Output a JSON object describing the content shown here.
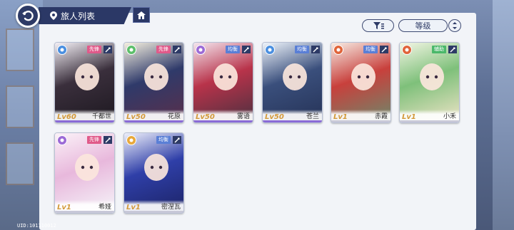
{
  "header": {
    "title": "旅人列表",
    "back_icon": "back-arrow-icon",
    "home_icon": "home-icon",
    "pin_icon": "location-pin-icon"
  },
  "toolbar": {
    "filter_icon": "filter-icon",
    "sort_label": "等级",
    "order_icon": "sort-order-icon"
  },
  "colors": {
    "accent": "#2b3866",
    "panel": "#f2f4f8",
    "role_vanguard": "#e05a8a",
    "role_balanced": "#5a7fd6",
    "role_support": "#4ab86a"
  },
  "characters": [
    {
      "name": "千都世",
      "level": "Lv60",
      "role": "先锋",
      "element": "water",
      "elem_color": "#4a8fe0"
    },
    {
      "name": "花原",
      "level": "Lv50",
      "role": "先锋",
      "element": "wind",
      "elem_color": "#5cbf6a"
    },
    {
      "name": "雾语",
      "level": "Lv50",
      "role": "均衡",
      "element": "moon",
      "elem_color": "#9c6ad6"
    },
    {
      "name": "苍兰",
      "level": "Lv50",
      "role": "均衡",
      "element": "water",
      "elem_color": "#4a8fe0"
    },
    {
      "name": "赤霞",
      "level": "Lv1",
      "role": "均衡",
      "element": "fire",
      "elem_color": "#e0643a"
    },
    {
      "name": "小禾",
      "level": "Lv1",
      "role": "辅助",
      "element": "fire",
      "elem_color": "#e0643a"
    },
    {
      "name": "希娅",
      "level": "Lv1",
      "role": "先锋",
      "element": "moon",
      "elem_color": "#9c6ad6"
    },
    {
      "name": "密涅瓦",
      "level": "Lv1",
      "role": "均衡",
      "element": "light",
      "elem_color": "#e8a83a"
    }
  ],
  "footer": {
    "uid": "UID:101110012"
  }
}
